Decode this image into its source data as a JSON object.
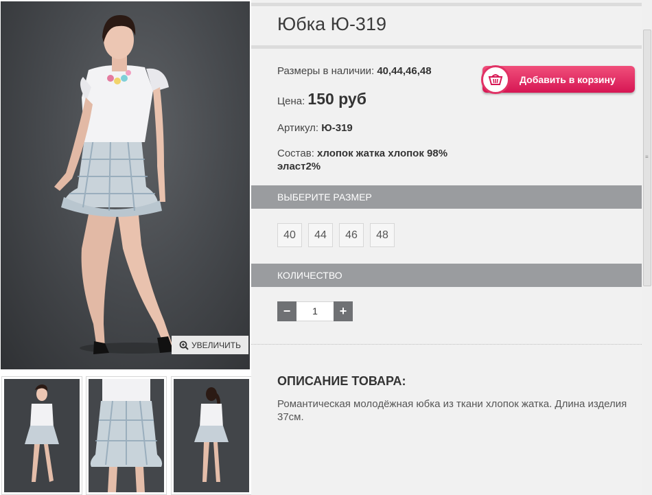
{
  "product": {
    "title": "Юбка Ю-319",
    "sizes_label": "Размеры в наличии:",
    "sizes_value": "40,44,46,48",
    "price_label": "Цена:",
    "price_value": "150 руб",
    "article_label": "Артикул:",
    "article_value": "Ю-319",
    "composition_label": "Состав:",
    "composition_value_1": "хлопок жатка хлопок 98%",
    "composition_value_2": "эласт2%"
  },
  "cart_button": {
    "label": "Добавить в корзину",
    "icon": "basket-icon"
  },
  "gallery": {
    "zoom_label": "УВЕЛИЧИТЬ",
    "zoom_icon": "magnifier-plus-icon"
  },
  "size_section": {
    "title": "ВЫБЕРИТЕ РАЗМЕР",
    "options": [
      "40",
      "44",
      "46",
      "48"
    ]
  },
  "quantity_section": {
    "title": "КОЛИЧЕСТВО",
    "minus": "−",
    "value": "1",
    "plus": "+"
  },
  "description": {
    "title": "ОПИСАНИЕ ТОВАРА:",
    "text": "Романтическая молодёжная юбка из ткани хлопок жатка. Длина изделия 37см."
  },
  "colors": {
    "accent": "#d61653",
    "section_bar": "#9a9c9f",
    "panel_bg": "#f1f1f1"
  }
}
